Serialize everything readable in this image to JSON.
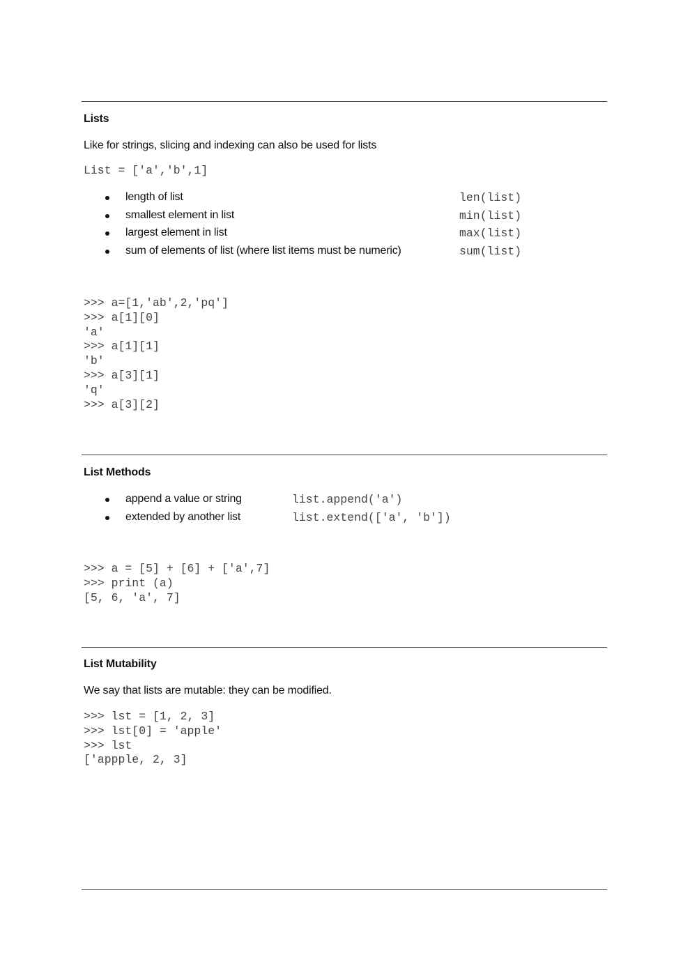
{
  "sections": [
    {
      "title": "Lists",
      "intro": "Like for strings, slicing and indexing can also be used for lists",
      "code_example": "List = ['a','b',1]",
      "bullets": [
        {
          "text": "length of list",
          "code": "len(list)"
        },
        {
          "text": "smallest element in list",
          "code": "min(list)"
        },
        {
          "text": "largest element in list",
          "code": "max(list)"
        },
        {
          "text": "sum of elements of list (where list items must be numeric)",
          "code": "sum(list)"
        }
      ],
      "repl": [
        ">>> a=[1,'ab',2,'pq']",
        ">>> a[1][0]",
        "'a'",
        ">>> a[1][1]",
        "'b'",
        ">>> a[3][1]",
        "'q'",
        ">>> a[3][2]"
      ]
    },
    {
      "title": "List Methods",
      "bullets": [
        {
          "text": "append a value or string",
          "code": "list.append('a')"
        },
        {
          "text": "extended by another list",
          "code": "list.extend(['a', 'b'])"
        }
      ],
      "repl": [
        ">>> a = [5] + [6] + ['a',7]",
        ">>> print (a)",
        "[5, 6, 'a', 7]"
      ]
    },
    {
      "title": "List Mutability",
      "intro": "We say that lists are mutable: they can be modified.",
      "repl": [
        ">>> lst = [1, 2, 3]",
        ">>> lst[0] = 'apple'",
        ">>> lst",
        "['appple, 2, 3]"
      ]
    }
  ]
}
